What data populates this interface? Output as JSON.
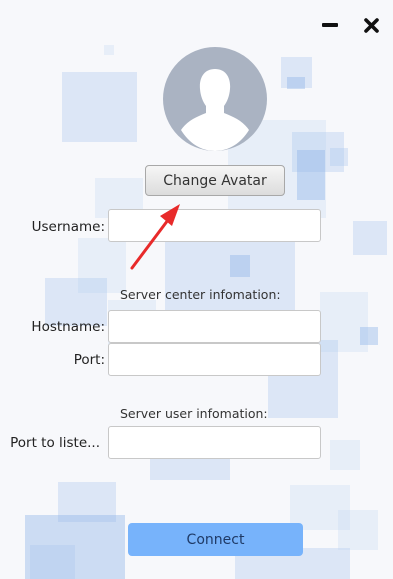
{
  "window": {
    "minimize_icon": "minimize-icon",
    "close_icon": "close-icon"
  },
  "avatar": {
    "icon": "user-silhouette-icon"
  },
  "buttons": {
    "change_avatar": "Change Avatar",
    "connect": "Connect"
  },
  "form": {
    "username_label": "Username:",
    "username_value": "",
    "server_center_title": "Server center infomation:",
    "hostname_label": "Hostname:",
    "hostname_value": "",
    "port_label": "Port:",
    "port_value": "",
    "server_user_title": "Server user infomation:",
    "listen_port_label": "Port to liste...",
    "listen_port_value": ""
  },
  "annotation": {
    "arrow_color": "#e82a2a",
    "icon": "red-arrow-annotation"
  },
  "colors": {
    "connect_button": "#77b3fb",
    "background_squares": "#aac6ee",
    "avatar": "#aab3c2"
  }
}
